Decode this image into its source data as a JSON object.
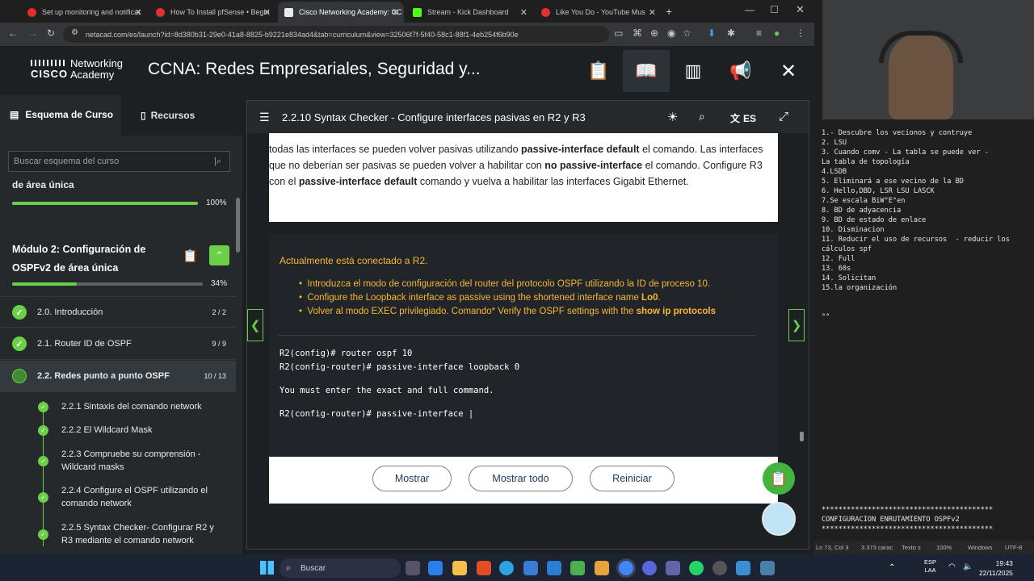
{
  "browser": {
    "tabs": [
      {
        "title": "Set up monitoring and notificat"
      },
      {
        "title": "How To Install pfSense • Begin"
      },
      {
        "title": "Cisco Networking Academy: CC"
      },
      {
        "title": "Stream - Kick Dashboard"
      },
      {
        "title": "Like You Do - YouTube Mus"
      }
    ],
    "url": "netacad.com/es/launch?id=8d380b31-29e0-41a8-8825-b9221e834ad4&tab=curriculum&view=32506f7f-5f40-58c1-88f1-4eb254f6b90e",
    "new_tab": "+"
  },
  "header": {
    "logo_line1": "Networking",
    "logo_line2": "Academy",
    "cisco": "CISCO",
    "course_title": "CCNA: Redes Empresariales, Seguridad y..."
  },
  "sidebar": {
    "tab_outline": "Esquema de Curso",
    "tab_resources": "Recursos",
    "search_placeholder": "Buscar esquema del curso",
    "prev_module_tail": "de área única",
    "prev_module_pct": "100%",
    "prev_module_progress": 1.0,
    "module2_title_l1": "Módulo 2: Configuración de",
    "module2_title_l2": "OSPFv2 de área única",
    "module2_pct": "34%",
    "module2_progress": 0.34,
    "sections": [
      {
        "label": "2.0. Introducción",
        "count": "2 / 2"
      },
      {
        "label": "2.1. Router ID de OSPF",
        "count": "9 / 9"
      },
      {
        "label": "2.2. Redes punto a punto OSPF",
        "count": "10 / 13"
      }
    ],
    "subitems": [
      {
        "l1": "2.2.1 Sintaxis del comando network",
        "l2": ""
      },
      {
        "l1": "2.2.2 El Wildcard Mask",
        "l2": ""
      },
      {
        "l1": "2.2.3 Compruebe su comprensión -",
        "l2": "Wildcard masks"
      },
      {
        "l1": "2.2.4 Configure el OSPF utilizando el",
        "l2": "comando network"
      },
      {
        "l1": "2.2.5 Syntax Checker- Configurar R2 y",
        "l2": "R3 mediante el comando network"
      }
    ]
  },
  "panel": {
    "title": "2.2.10 Syntax Checker - Configure interfaces pasivas en R2 y R3",
    "lang": "ES",
    "para": {
      "a1": "todas las interfaces se pueden volver pasivas utilizando ",
      "b1": "passive-interface default",
      "a2": " el comando. Las interfaces que no deberían ser pasivas se pueden volver a habilitar con ",
      "b2": "no passive-interface",
      "a3": " el comando. Configure R3 con el ",
      "b3": "passive-interface default",
      "a4": " comando y vuelva a habilitar las interfaces Gigabit Ethernet."
    },
    "intro": "Actualmente está conectado a R2.",
    "bullets": [
      {
        "text": "Introduzca el modo de configuración del router del protocolo OSPF utilizando la ID de proceso 10.",
        "bold": ""
      },
      {
        "text": "Configure the Loopback interface as passive using the shortened interface name ",
        "bold": "Lo0",
        "tail": "."
      },
      {
        "text": "Volver al modo EXEC privilegiado. Comando* Verify the OSPF settings with the ",
        "bold": "show ip protocols",
        "tail": ""
      }
    ],
    "terminal": [
      "R2(config)# router ospf 10",
      "R2(config-router)# passive-interface loopback 0",
      "You must enter the exact and full command.",
      "R2(config-router)# passive-interface |"
    ],
    "buttons": {
      "show": "Mostrar",
      "show_all": "Mostrar todo",
      "reset": "Reiniciar"
    }
  },
  "notepad": {
    "lines": [
      "1.- Descubre los vecionos y contruye",
      "2. LSU",
      "3. Cuando comv - La tabla se puede ver -",
      "La tabla de topología",
      "4.LSDB",
      "5. Eliminará a ese vecino de la BD",
      "6. Hello,DBD, LSR LSU LASCK",
      "7.Se escala BiW°E°en",
      "8. BD de adyacencia",
      "9. BD de estado de enlace",
      "10. Disminacion",
      "11. Reducir el uso de recursos  - reducir los",
      "cálculos spf",
      "12. Full",
      "13. 60s",
      "14. Solicitan",
      "15.la organización",
      "",
      "",
      "°°"
    ],
    "bottom": [
      "*****************************************",
      "CONFIGURACION ENRUTAMIENTO OSPFv2",
      "*****************************************"
    ],
    "status": {
      "pos": "Ln 73, Col 3",
      "chars": "3.373 carac",
      "mode": "Texto s",
      "zoom": "100%",
      "eol": "Windows",
      "enc": "UTF-8"
    }
  },
  "taskbar": {
    "search": "Buscar",
    "lang1": "ESP",
    "lang2": "LAA",
    "time": "19:43",
    "date": "22/11/2025"
  }
}
